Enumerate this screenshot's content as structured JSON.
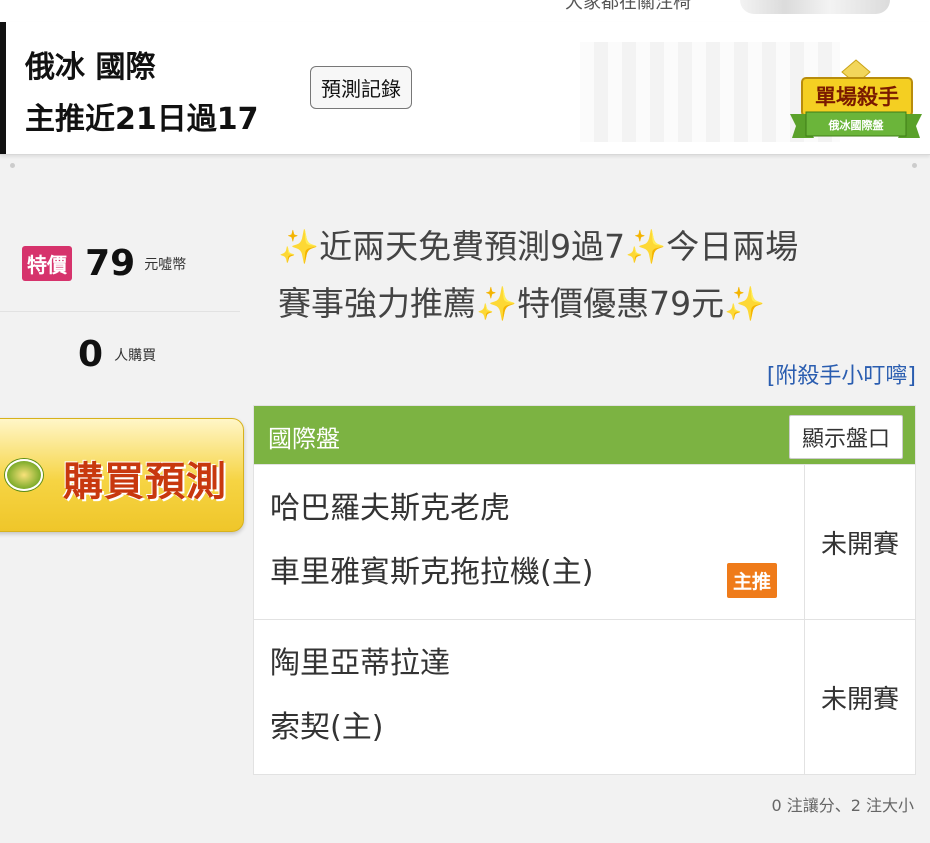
{
  "top_strip": {
    "cut_text": "大家都在關注椅"
  },
  "header": {
    "title_line1": "俄冰 國際",
    "title_line2": "主推近21日過17",
    "history_button": "預測記錄",
    "badge_main": "單場殺手",
    "badge_sub": "俄冰國際盤"
  },
  "pricing": {
    "special_tag": "特價",
    "price": "79",
    "currency": "元噓幣",
    "buyers_count": "0",
    "buyers_label": "人購買",
    "buy_button": "購買預測"
  },
  "promo": {
    "line1_a": "近兩天免費預測9過7",
    "line1_b": "今日兩場",
    "line2_a": "賽事強力推薦",
    "line2_b": "特價優惠79元",
    "sparkle": "✨"
  },
  "attach_link": "[附殺手小叮嚀]",
  "table": {
    "market": "國際盤",
    "show_odds_button": "顯示盤口",
    "rows": [
      {
        "team_away": "哈巴羅夫斯克老虎",
        "team_home": "車里雅賓斯克拖拉機(主)",
        "pick_badge": "主推",
        "status": "未開賽"
      },
      {
        "team_away": "陶里亞蒂拉達",
        "team_home": "索契(主)",
        "status": "未開賽"
      }
    ]
  },
  "footnote": "0 注讓分、2 注大小",
  "colors": {
    "green_header": "#7cb342",
    "special_tag": "#d6336c",
    "pick_badge": "#ef7b1a",
    "link": "#2a5db0"
  }
}
